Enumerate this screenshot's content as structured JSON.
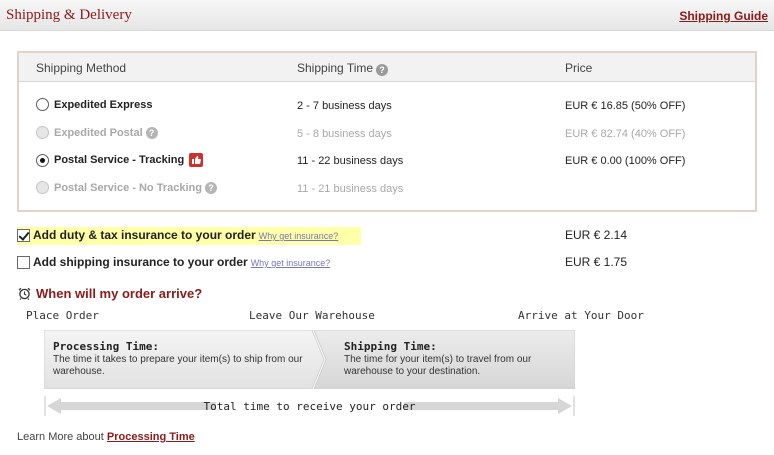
{
  "header": {
    "title": "Shipping & Delivery",
    "guide_link": "Shipping Guide"
  },
  "table": {
    "headers": {
      "method": "Shipping Method",
      "time": "Shipping Time",
      "price": "Price"
    },
    "rows": [
      {
        "method": "Expedited Express",
        "time": "2 - 7 business days",
        "price": "EUR € 16.85 (50% OFF)",
        "selected": false,
        "disabled": false
      },
      {
        "method": "Expedited Postal",
        "time": "5 - 8 business days",
        "price": "EUR € 82.74 (40% OFF)",
        "selected": false,
        "disabled": true
      },
      {
        "method": "Postal Service - Tracking",
        "time": "11 - 22 business days",
        "price": "EUR € 0.00 (100% OFF)",
        "selected": true,
        "disabled": false
      },
      {
        "method": "Postal Service - No Tracking",
        "time": "11 - 21 business days",
        "price": "",
        "selected": false,
        "disabled": true
      }
    ]
  },
  "options": {
    "duty": {
      "label": "Add duty & tax insurance to your order",
      "link": "Why get insurance?",
      "price": "EUR € 2.14",
      "checked": true
    },
    "shipping": {
      "label": "Add shipping insurance to your order",
      "link": "Why get insurance?",
      "price": "EUR € 1.75",
      "checked": false
    }
  },
  "arrival": {
    "title": "When will my order arrive?",
    "labels": {
      "place_order": "Place Order",
      "leave_warehouse": "Leave Our Warehouse",
      "arrive": "Arrive at Your Door"
    },
    "processing": {
      "title": "Processing Time:",
      "desc": "The time it takes to prepare your item(s) to ship from our warehouse."
    },
    "shipping": {
      "title": "Shipping Time:",
      "desc": "The time  for your item(s) to travel from our warehouse to your destination."
    },
    "total": "Total time to receive your order"
  },
  "learn": {
    "prefix": "Learn More about",
    "link": "Processing Time"
  },
  "colors": {
    "brand": "#8b1a1a",
    "highlight": "#ffffa8",
    "thumb": "#d0302c"
  }
}
